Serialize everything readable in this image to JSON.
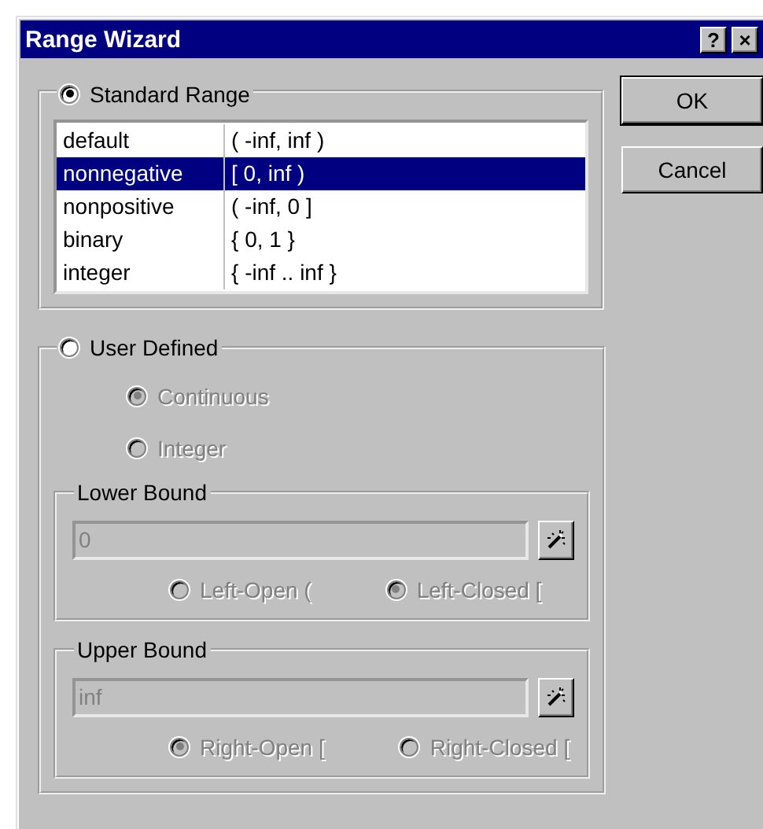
{
  "window": {
    "title": "Range Wizard",
    "help_button": "?",
    "close_button": "×"
  },
  "range_type": [
    {
      "label": "Standard Range",
      "selected": true
    },
    {
      "label": "User Defined",
      "selected": false
    }
  ],
  "standard_ranges": [
    {
      "name": "default",
      "range": "( -inf, inf )",
      "selected": false
    },
    {
      "name": "nonnegative",
      "range": "[ 0, inf )",
      "selected": true
    },
    {
      "name": "nonpositive",
      "range": "( -inf, 0 ]",
      "selected": false
    },
    {
      "name": "binary",
      "range": "{ 0, 1 }",
      "selected": false
    },
    {
      "name": "integer",
      "range": "{ -inf .. inf }",
      "selected": false
    }
  ],
  "user_defined": {
    "disabled": true,
    "domain": [
      {
        "label": "Continuous",
        "selected": true
      },
      {
        "label": "Integer",
        "selected": false
      }
    ],
    "lower_bound": {
      "title": "Lower Bound",
      "value": "0",
      "options": [
        {
          "label": "Left-Open (",
          "selected": false
        },
        {
          "label": "Left-Closed [",
          "selected": true
        }
      ]
    },
    "upper_bound": {
      "title": "Upper Bound",
      "value": "inf",
      "options": [
        {
          "label": "Right-Open [",
          "selected": true
        },
        {
          "label": "Right-Closed [",
          "selected": false
        }
      ]
    }
  },
  "buttons": [
    "OK",
    "Cancel"
  ]
}
